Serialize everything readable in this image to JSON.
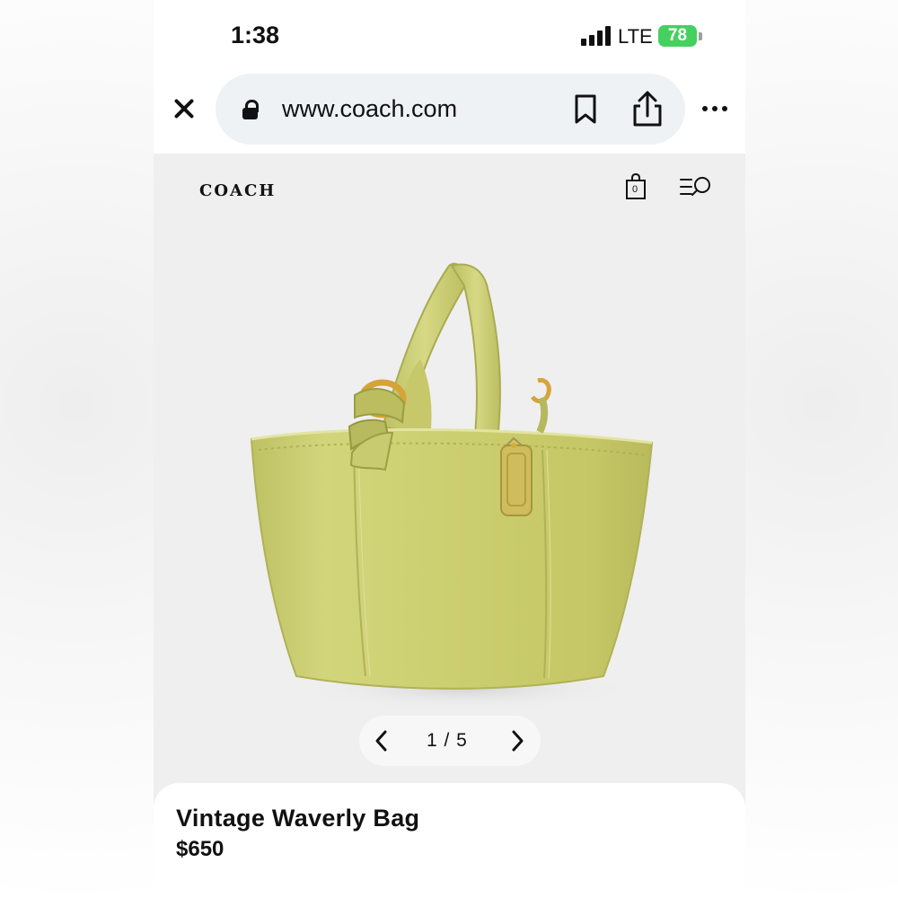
{
  "status_bar": {
    "time": "1:38",
    "network": "LTE",
    "battery": "78"
  },
  "browser": {
    "url": "www.coach.com",
    "icons": {
      "close": "close-icon",
      "lock": "lock-icon",
      "bookmark": "bookmark-icon",
      "share": "share-icon",
      "more": "more-icon"
    }
  },
  "site_header": {
    "logo": "COACH",
    "cart_count": "0",
    "icons": {
      "cart": "shopping-bag-icon",
      "menu_search": "menu-search-icon"
    }
  },
  "gallery": {
    "current_image": "1",
    "total_images": "5",
    "label": "1 / 5",
    "icons": {
      "previous": "chevron-left-icon",
      "next": "chevron-right-icon"
    }
  },
  "product": {
    "name": "Vintage Waverly Bag",
    "price": "$650",
    "color": "#c9cb6c"
  },
  "colors": {
    "battery": "#46d05f",
    "url_field": "#eef2f5",
    "hero_background": "#efeff0",
    "bag_green": "#c9cb6c",
    "hardware_gold": "#d3a33b"
  }
}
